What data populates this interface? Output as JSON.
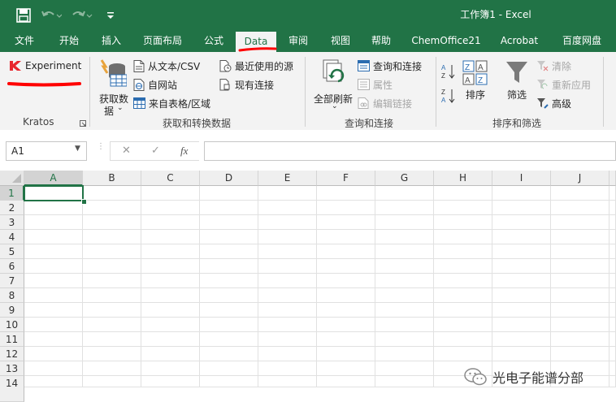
{
  "titlebar": {
    "title": "工作簿1  -  Excel",
    "save_icon": "save-icon",
    "undo_icon": "undo-icon",
    "redo_icon": "redo-icon",
    "qat_icon": "customize-qat-icon"
  },
  "tabs": [
    {
      "label": "文件"
    },
    {
      "label": "开始"
    },
    {
      "label": "插入"
    },
    {
      "label": "页面布局"
    },
    {
      "label": "公式"
    },
    {
      "label": "Data"
    },
    {
      "label": "审阅"
    },
    {
      "label": "视图"
    },
    {
      "label": "帮助"
    },
    {
      "label": "ChemOffice21"
    },
    {
      "label": "Acrobat"
    },
    {
      "label": "百度网盘"
    }
  ],
  "ribbon": {
    "kratos": {
      "button": "Experiment",
      "group": "Kratos"
    },
    "get_data": {
      "big_button_line1": "获取数",
      "big_button_line2": "据",
      "from_text": "从文本/CSV",
      "from_web": "自网站",
      "from_table": "来自表格/区域",
      "recent_sources": "最近使用的源",
      "existing": "现有连接",
      "group": "获取和转换数据"
    },
    "queries": {
      "refresh_all": "全部刷新",
      "queries_connections": "查询和连接",
      "properties": "属性",
      "edit_links": "编辑链接",
      "group": "查询和连接"
    },
    "sort_filter": {
      "sort": "排序",
      "filter": "筛选",
      "clear": "清除",
      "reapply": "重新应用",
      "advanced": "高级",
      "group": "排序和筛选"
    },
    "colors": {
      "accent": "#217346",
      "red_mark": "#ff0000"
    }
  },
  "formula_bar": {
    "name_box": "A1",
    "cancel": "✕",
    "enter": "✓",
    "fx": "fx",
    "value": ""
  },
  "sheet": {
    "columns": [
      "A",
      "B",
      "C",
      "D",
      "E",
      "F",
      "G",
      "H",
      "I",
      "J"
    ],
    "rows": [
      "1",
      "2",
      "3",
      "4",
      "5",
      "6",
      "7",
      "8",
      "9",
      "10",
      "11",
      "12",
      "13",
      "14"
    ],
    "selected_cell": "A1"
  },
  "watermark": {
    "text": "光电子能谱分部",
    "icon": "wechat-icon"
  }
}
